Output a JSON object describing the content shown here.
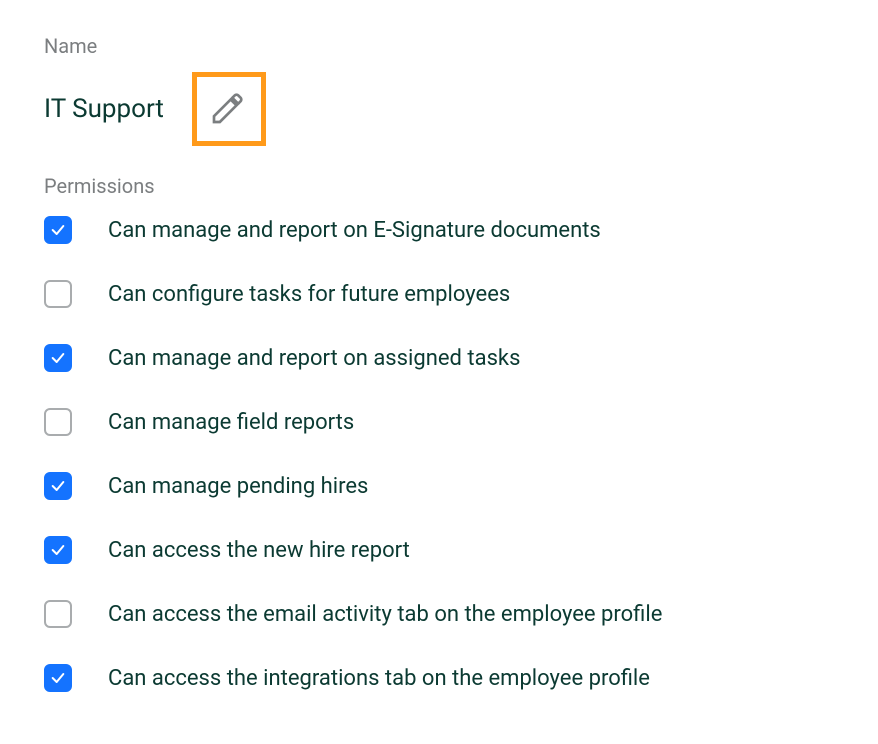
{
  "name_section": {
    "label": "Name",
    "value": "IT Support"
  },
  "permissions_section": {
    "label": "Permissions",
    "items": [
      {
        "label": "Can manage and report on E-Signature documents",
        "checked": true
      },
      {
        "label": "Can configure tasks for future employees",
        "checked": false
      },
      {
        "label": "Can manage and report on assigned tasks",
        "checked": true
      },
      {
        "label": "Can manage field reports",
        "checked": false
      },
      {
        "label": "Can manage pending hires",
        "checked": true
      },
      {
        "label": "Can access the new hire report",
        "checked": true
      },
      {
        "label": "Can access the email activity tab on the employee profile",
        "checked": false
      },
      {
        "label": "Can access the integrations tab on the employee profile",
        "checked": true
      }
    ]
  },
  "colors": {
    "accent_blue": "#1473ff",
    "highlight_orange": "#ff9a1a",
    "text_primary": "#0b3a32",
    "text_muted": "#7b7e80"
  }
}
